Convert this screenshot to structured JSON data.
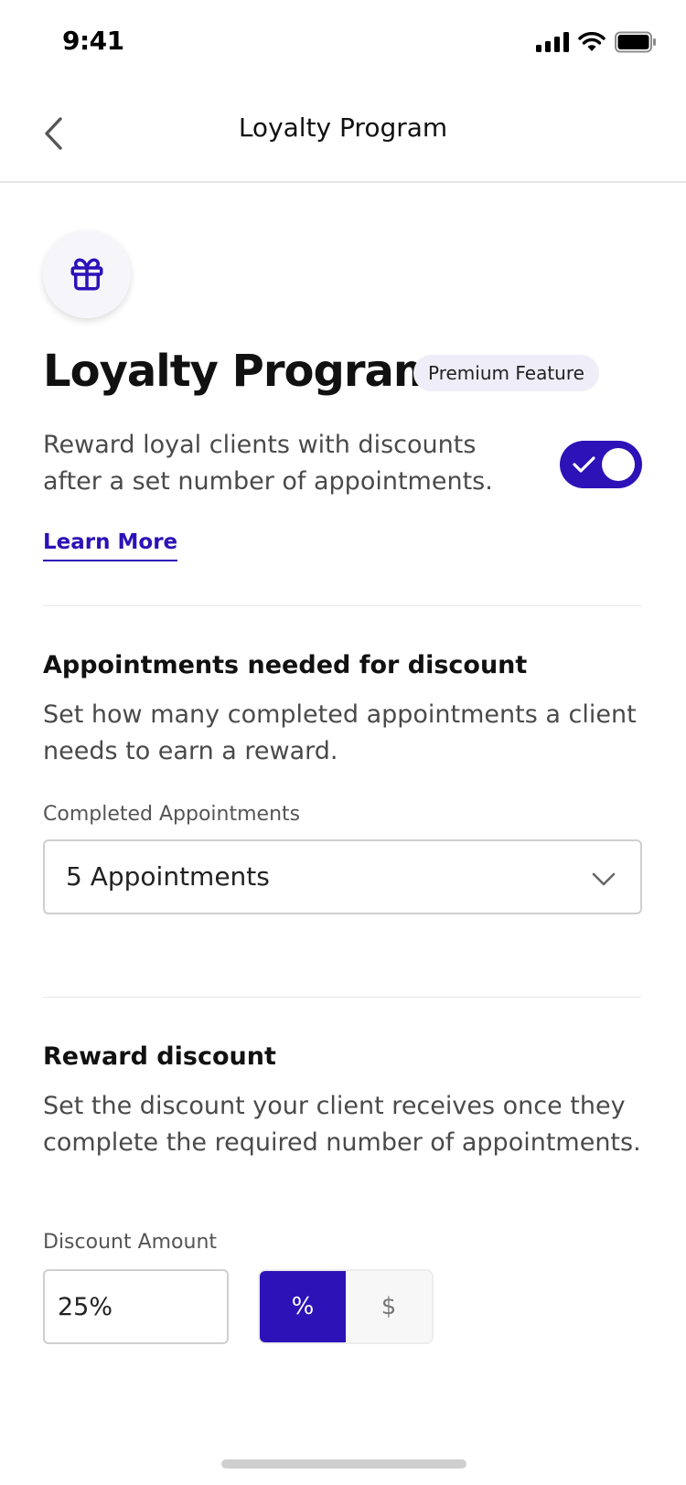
{
  "status_bar": {
    "time": "9:41",
    "icons": [
      "signal-icon",
      "wifi-icon",
      "battery-icon"
    ]
  },
  "nav": {
    "back_icon": "chevron-left-icon",
    "title": "Loyalty Program"
  },
  "hero": {
    "icon": "gift-icon",
    "title": "Loyalty Program",
    "badge": "Premium Feature",
    "description": "Reward loyal clients with discounts after a set number of appointments.",
    "toggle_enabled": true,
    "learn_more": "Learn More"
  },
  "appointments_section": {
    "title": "Appointments needed for discount",
    "description": "Set how many completed appointments a client needs to earn a reward.",
    "field_label": "Completed Appointments",
    "selected_value": "5 Appointments"
  },
  "reward_section": {
    "title": "Reward discount",
    "description": "Set the discount your client receives once they complete the required number of appointments.",
    "field_label": "Discount Amount",
    "amount_value": "25%",
    "unit_options": [
      "%",
      "$"
    ],
    "selected_unit": "%"
  },
  "colors": {
    "accent": "#2d12b8",
    "badge_bg": "#efedf7",
    "text_primary": "#111111",
    "text_secondary": "#4a4a4a",
    "border": "#cfcfcf"
  }
}
